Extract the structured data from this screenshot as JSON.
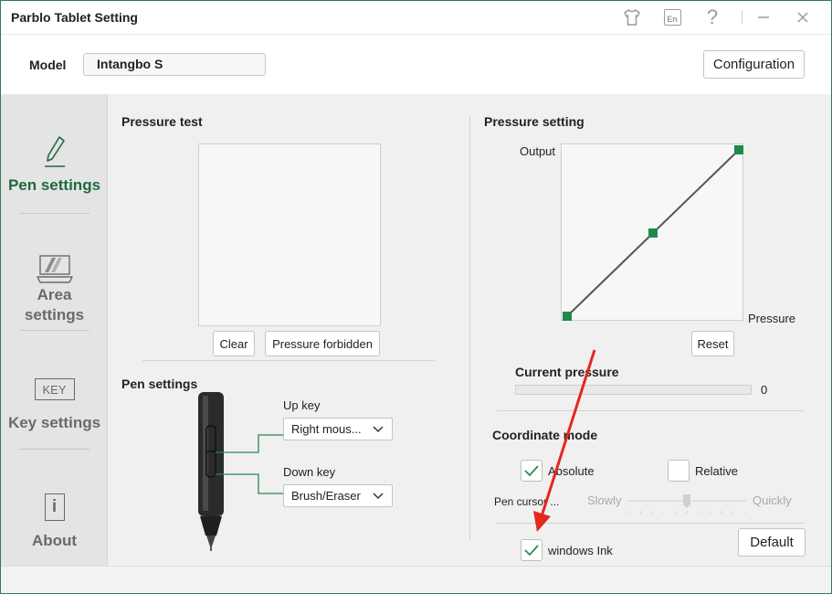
{
  "app": {
    "title": "Parblo Tablet Setting"
  },
  "titlebar": {
    "icons": [
      "tshirt-icon",
      "language-en-icon",
      "help-icon",
      "minimize-icon",
      "close-icon"
    ],
    "lang_badge": "En",
    "help_glyph": "?"
  },
  "header": {
    "model_label": "Model",
    "model_value": "Intangbo S",
    "configuration_label": "Configuration"
  },
  "sidebar": {
    "items": [
      {
        "label": "Pen settings",
        "icon": "pen-icon",
        "active": true
      },
      {
        "label": "Area settings",
        "label_lines": [
          "Area",
          "settings"
        ],
        "icon": "tablet-area-icon",
        "active": false
      },
      {
        "label": "Key settings",
        "icon": "key-icon",
        "icon_text": "KEY",
        "active": false
      },
      {
        "label": "About",
        "icon": "info-icon",
        "icon_text": "i",
        "active": false
      }
    ]
  },
  "pressure_test": {
    "title": "Pressure test",
    "clear_label": "Clear",
    "forbidden_label": "Pressure forbidden"
  },
  "pen_settings": {
    "title": "Pen settings",
    "up_key_label": "Up key",
    "up_key_value": "Right mous...",
    "down_key_label": "Down key",
    "down_key_value": "Brush/Eraser"
  },
  "pressure_setting": {
    "title": "Pressure setting",
    "output_label": "Output",
    "pressure_label": "Pressure",
    "reset_label": "Reset",
    "curve_points": [
      [
        0,
        0
      ],
      [
        0.5,
        0.5
      ],
      [
        1,
        1
      ]
    ]
  },
  "current_pressure": {
    "title": "Current pressure",
    "value": "0",
    "fraction": 0
  },
  "coordinate_mode": {
    "title": "Coordinate mode",
    "absolute_label": "Absolute",
    "absolute_checked": true,
    "relative_label": "Relative",
    "relative_checked": false,
    "pen_cursor_label": "Pen cursor ...",
    "slow_label": "Slowly",
    "quick_label": "Quickly",
    "speed_fraction": 0.5
  },
  "windows_ink": {
    "label": "windows Ink",
    "checked": true
  },
  "default_label": "Default",
  "colors": {
    "accent": "#1c6b3a",
    "marker": "#1f8a4c",
    "arrow": "#e5271e",
    "border": "#2f7d55"
  }
}
